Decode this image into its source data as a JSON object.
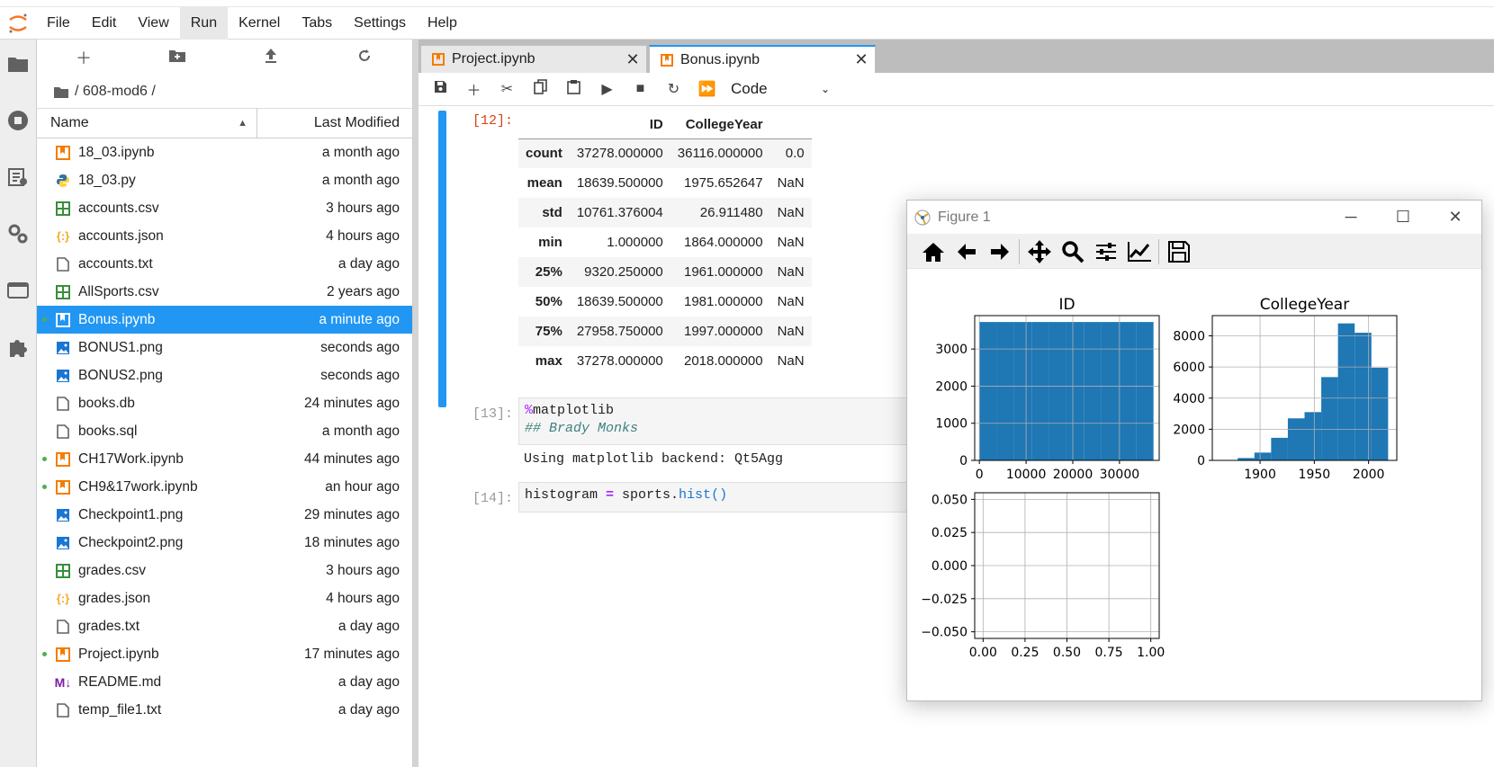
{
  "menu": [
    "File",
    "Edit",
    "View",
    "Run",
    "Kernel",
    "Tabs",
    "Settings",
    "Help"
  ],
  "menu_active": "Run",
  "breadcrumb": "/ 608-mod6 /",
  "file_header": {
    "name": "Name",
    "modified": "Last Modified"
  },
  "files": [
    {
      "name": "18_03.ipynb",
      "modified": "a month ago",
      "type": "notebook",
      "running": false,
      "selected": false
    },
    {
      "name": "18_03.py",
      "modified": "a month ago",
      "type": "python",
      "running": false,
      "selected": false
    },
    {
      "name": "accounts.csv",
      "modified": "3 hours ago",
      "type": "csv",
      "running": false,
      "selected": false
    },
    {
      "name": "accounts.json",
      "modified": "4 hours ago",
      "type": "json",
      "running": false,
      "selected": false
    },
    {
      "name": "accounts.txt",
      "modified": "a day ago",
      "type": "file",
      "running": false,
      "selected": false
    },
    {
      "name": "AllSports.csv",
      "modified": "2 years ago",
      "type": "csv",
      "running": false,
      "selected": false
    },
    {
      "name": "Bonus.ipynb",
      "modified": "a minute ago",
      "type": "notebook",
      "running": true,
      "selected": true
    },
    {
      "name": "BONUS1.png",
      "modified": "seconds ago",
      "type": "image",
      "running": false,
      "selected": false
    },
    {
      "name": "BONUS2.png",
      "modified": "seconds ago",
      "type": "image",
      "running": false,
      "selected": false
    },
    {
      "name": "books.db",
      "modified": "24 minutes ago",
      "type": "file",
      "running": false,
      "selected": false
    },
    {
      "name": "books.sql",
      "modified": "a month ago",
      "type": "file",
      "running": false,
      "selected": false
    },
    {
      "name": "CH17Work.ipynb",
      "modified": "44 minutes ago",
      "type": "notebook",
      "running": true,
      "selected": false
    },
    {
      "name": "CH9&17work.ipynb",
      "modified": "an hour ago",
      "type": "notebook",
      "running": true,
      "selected": false
    },
    {
      "name": "Checkpoint1.png",
      "modified": "29 minutes ago",
      "type": "image",
      "running": false,
      "selected": false
    },
    {
      "name": "Checkpoint2.png",
      "modified": "18 minutes ago",
      "type": "image",
      "running": false,
      "selected": false
    },
    {
      "name": "grades.csv",
      "modified": "3 hours ago",
      "type": "csv",
      "running": false,
      "selected": false
    },
    {
      "name": "grades.json",
      "modified": "4 hours ago",
      "type": "json",
      "running": false,
      "selected": false
    },
    {
      "name": "grades.txt",
      "modified": "a day ago",
      "type": "file",
      "running": false,
      "selected": false
    },
    {
      "name": "Project.ipynb",
      "modified": "17 minutes ago",
      "type": "notebook",
      "running": true,
      "selected": false
    },
    {
      "name": "README.md",
      "modified": "a day ago",
      "type": "markdown",
      "running": false,
      "selected": false
    },
    {
      "name": "temp_file1.txt",
      "modified": "a day ago",
      "type": "file",
      "running": false,
      "selected": false
    }
  ],
  "tabs": [
    {
      "label": "Project.ipynb",
      "active": false
    },
    {
      "label": "Bonus.ipynb",
      "active": true
    }
  ],
  "cell_type": "Code",
  "cells": {
    "c12": {
      "prompt": "[12]:"
    },
    "c13": {
      "prompt": "[13]:",
      "line1_magic": "%",
      "line1_rest": "matplotlib",
      "line2": "## Brady Monks",
      "output": "Using matplotlib backend: Qt5Agg"
    },
    "c14": {
      "prompt": "[14]:",
      "code_a": "histogram ",
      "code_op": "=",
      "code_b": " sports.",
      "code_fn": "hist",
      "code_c": "()"
    }
  },
  "df_table": {
    "columns": [
      "",
      "ID",
      "CollegeYear",
      ""
    ],
    "rows": [
      [
        "count",
        "37278.000000",
        "36116.000000",
        "0.0"
      ],
      [
        "mean",
        "18639.500000",
        "1975.652647",
        "NaN"
      ],
      [
        "std",
        "10761.376004",
        "26.911480",
        "NaN"
      ],
      [
        "min",
        "1.000000",
        "1864.000000",
        "NaN"
      ],
      [
        "25%",
        "9320.250000",
        "1961.000000",
        "NaN"
      ],
      [
        "50%",
        "18639.500000",
        "1981.000000",
        "NaN"
      ],
      [
        "75%",
        "27958.750000",
        "1997.000000",
        "NaN"
      ],
      [
        "max",
        "37278.000000",
        "2018.000000",
        "NaN"
      ]
    ]
  },
  "figure_window": {
    "title": "Figure 1",
    "colors": {
      "bar": "#1f77b4"
    }
  },
  "chart_data": [
    {
      "type": "bar",
      "title": "ID",
      "xlim": [
        -1000,
        38500
      ],
      "ylim": [
        0,
        3900
      ],
      "xticks": [
        0,
        10000,
        20000,
        30000
      ],
      "yticks": [
        0,
        1000,
        2000,
        3000
      ],
      "bins": [
        [
          1,
          3728.7
        ],
        [
          3728.7,
          7456.4
        ],
        [
          7456.4,
          11184.1
        ],
        [
          11184.1,
          14911.8
        ],
        [
          14911.8,
          18639.5
        ],
        [
          18639.5,
          22367.2
        ],
        [
          22367.2,
          26094.9
        ],
        [
          26094.9,
          29822.6
        ],
        [
          29822.6,
          33550.3
        ],
        [
          33550.3,
          37278
        ]
      ],
      "values": [
        3728,
        3728,
        3728,
        3728,
        3728,
        3728,
        3728,
        3728,
        3728,
        3728
      ],
      "grid": true
    },
    {
      "type": "bar",
      "title": "CollegeYear",
      "xlim": [
        1856,
        2026
      ],
      "ylim": [
        0,
        9300
      ],
      "xticks": [
        1900,
        1950,
        2000
      ],
      "yticks": [
        0,
        2000,
        4000,
        6000,
        8000
      ],
      "bins": [
        [
          1864,
          1879.4
        ],
        [
          1879.4,
          1894.8
        ],
        [
          1894.8,
          1910.2
        ],
        [
          1910.2,
          1925.6
        ],
        [
          1925.6,
          1941
        ],
        [
          1941,
          1956.4
        ],
        [
          1956.4,
          1971.8
        ],
        [
          1971.8,
          1987.2
        ],
        [
          1987.2,
          2002.6
        ],
        [
          2002.6,
          2018
        ]
      ],
      "values": [
        20,
        150,
        500,
        1450,
        2700,
        3100,
        5350,
        8800,
        8200,
        5950
      ],
      "grid": true
    },
    {
      "type": "bar",
      "title": "",
      "xlim": [
        -0.05,
        1.05
      ],
      "ylim": [
        -0.055,
        0.055
      ],
      "xticks": [
        0.0,
        0.25,
        0.5,
        0.75,
        1.0
      ],
      "yticks": [
        -0.05,
        -0.025,
        0.0,
        0.025,
        0.05
      ],
      "xticklabels": [
        "0.00",
        "0.25",
        "0.50",
        "0.75",
        "1.00"
      ],
      "yticklabels": [
        "−0.050",
        "−0.025",
        "0.000",
        "0.025",
        "0.050"
      ],
      "bins": [],
      "values": [],
      "grid": true
    }
  ]
}
